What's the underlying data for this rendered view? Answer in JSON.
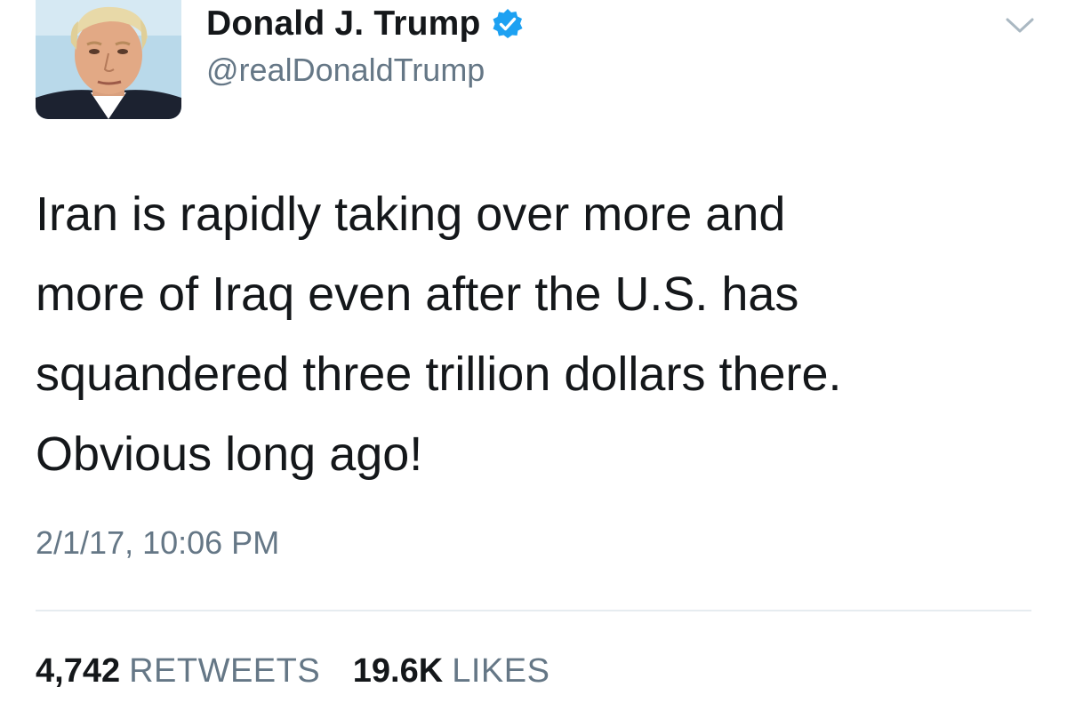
{
  "author": {
    "display_name": "Donald J. Trump",
    "handle": "@realDonaldTrump",
    "verified": true
  },
  "tweet": {
    "text": "Iran is rapidly taking over more and\nmore of Iraq even after the U.S. has\nsquandered three trillion dollars there.\nObvious long ago!",
    "timestamp": "2/1/17, 10:06 PM"
  },
  "stats": {
    "retweets_count": "4,742",
    "retweets_label": "RETWEETS",
    "likes_count": "19.6K",
    "likes_label": "LIKES"
  },
  "colors": {
    "verified_badge": "#1da1f2",
    "secondary_text": "#657786",
    "divider": "#e6ecf0"
  },
  "icons": {
    "verified": "verified-badge-icon",
    "menu": "chevron-down-icon"
  }
}
